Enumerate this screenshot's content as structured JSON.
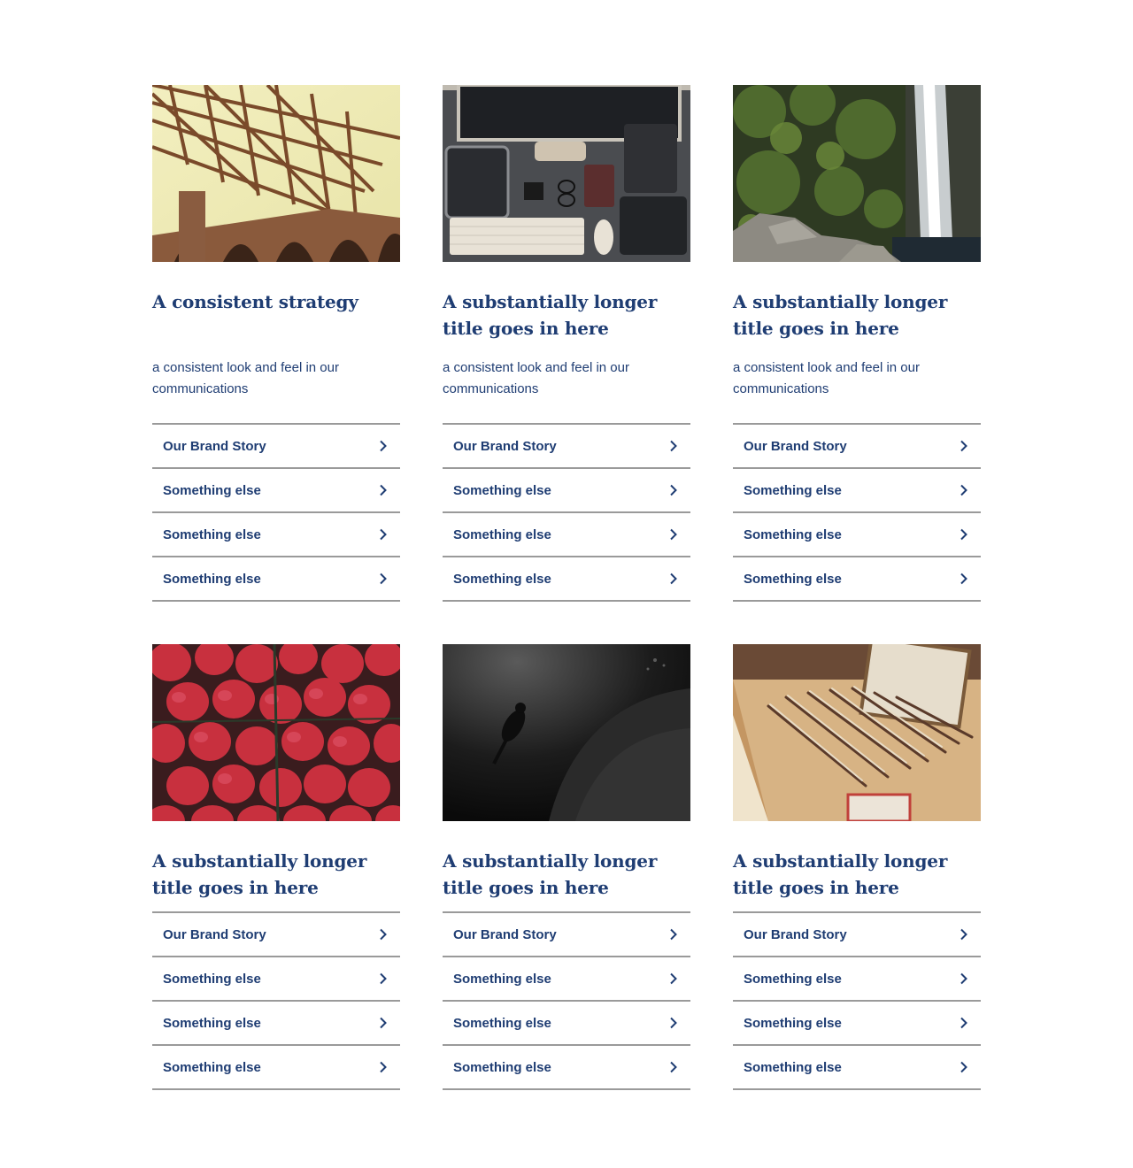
{
  "cards": [
    {
      "image": "golden-gate-bridge-photo",
      "title": "A consistent strategy",
      "description": "a consistent look and feel in our communications",
      "links": [
        {
          "label": "Our Brand Story",
          "icon": "chevron-right-icon"
        },
        {
          "label": "Something else",
          "icon": "chevron-right-icon"
        },
        {
          "label": "Something else",
          "icon": "chevron-right-icon"
        },
        {
          "label": "Something else",
          "icon": "chevron-right-icon"
        }
      ]
    },
    {
      "image": "desk-workspace-photo",
      "title": "A substantially longer title goes in here",
      "description": "a consistent look and feel in our communications",
      "links": [
        {
          "label": "Our Brand Story",
          "icon": "chevron-right-icon"
        },
        {
          "label": "Something else",
          "icon": "chevron-right-icon"
        },
        {
          "label": "Something else",
          "icon": "chevron-right-icon"
        },
        {
          "label": "Something else",
          "icon": "chevron-right-icon"
        }
      ]
    },
    {
      "image": "waterfall-photo",
      "title": "A substantially longer title goes in here",
      "description": "a consistent look and feel in our communications",
      "links": [
        {
          "label": "Our Brand Story",
          "icon": "chevron-right-icon"
        },
        {
          "label": "Something else",
          "icon": "chevron-right-icon"
        },
        {
          "label": "Something else",
          "icon": "chevron-right-icon"
        },
        {
          "label": "Something else",
          "icon": "chevron-right-icon"
        }
      ]
    },
    {
      "image": "strawberries-photo",
      "title": "A substantially longer title goes in here",
      "links": [
        {
          "label": "Our Brand Story",
          "icon": "chevron-right-icon"
        },
        {
          "label": "Something else",
          "icon": "chevron-right-icon"
        },
        {
          "label": "Something else",
          "icon": "chevron-right-icon"
        },
        {
          "label": "Something else",
          "icon": "chevron-right-icon"
        }
      ]
    },
    {
      "image": "underwater-diver-photo",
      "title": "A substantially longer title goes in here",
      "links": [
        {
          "label": "Our Brand Story",
          "icon": "chevron-right-icon"
        },
        {
          "label": "Something else",
          "icon": "chevron-right-icon"
        },
        {
          "label": "Something else",
          "icon": "chevron-right-icon"
        },
        {
          "label": "Something else",
          "icon": "chevron-right-icon"
        }
      ]
    },
    {
      "image": "pencils-on-table-photo",
      "title": "A substantially longer title goes in here",
      "links": [
        {
          "label": "Our Brand Story",
          "icon": "chevron-right-icon"
        },
        {
          "label": "Something else",
          "icon": "chevron-right-icon"
        },
        {
          "label": "Something else",
          "icon": "chevron-right-icon"
        },
        {
          "label": "Something else",
          "icon": "chevron-right-icon"
        }
      ]
    }
  ],
  "colors": {
    "text": "#1f3d73",
    "divider": "#9a9a9a",
    "background": "#ffffff"
  }
}
